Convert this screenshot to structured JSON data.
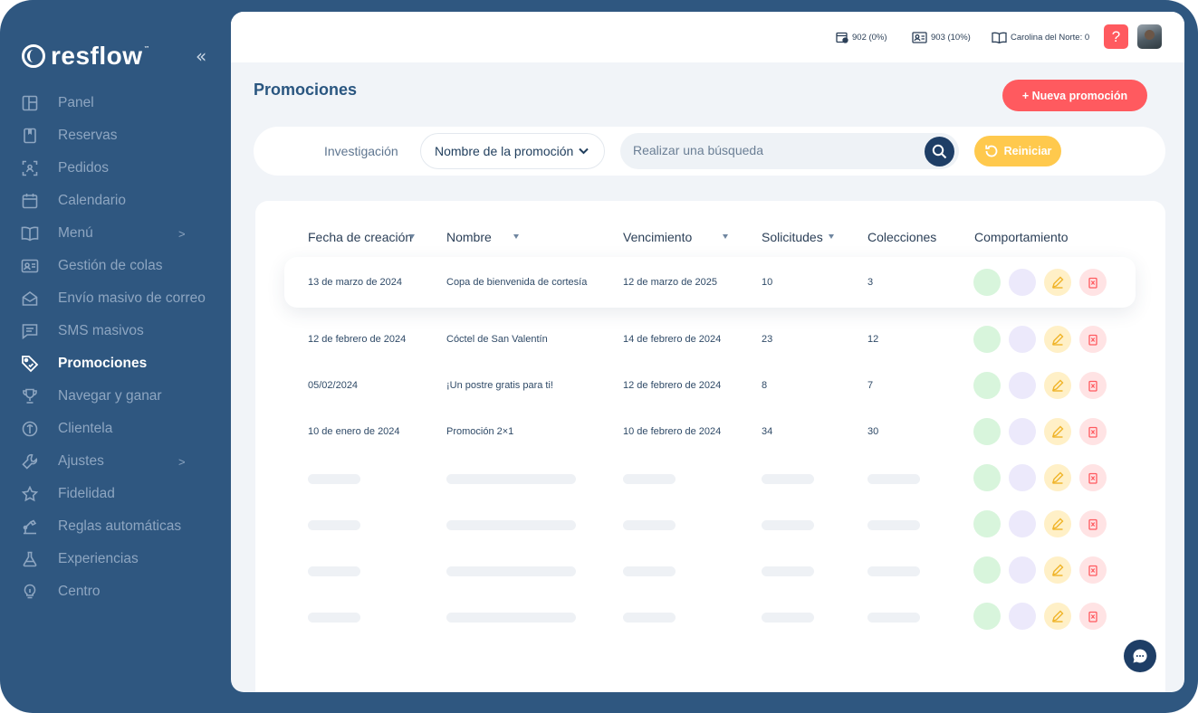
{
  "app": {
    "brand": "resflow",
    "trademark": "™",
    "collapse_icon": "«"
  },
  "sidebar": {
    "items": [
      {
        "label": "Panel",
        "icon": "panel-icon"
      },
      {
        "label": "Reservas",
        "icon": "book-icon"
      },
      {
        "label": "Pedidos",
        "icon": "scan-icon"
      },
      {
        "label": "Calendario",
        "icon": "calendar-icon"
      },
      {
        "label": "Menú",
        "icon": "menu-book-icon",
        "chevron": ">"
      },
      {
        "label": "Gestión de colas",
        "icon": "id-card-icon"
      },
      {
        "label": "Envío masivo de correo",
        "icon": "mail-icon"
      },
      {
        "label": "SMS masivos",
        "icon": "message-icon"
      },
      {
        "label": "Promociones",
        "icon": "tag-icon",
        "active": true
      },
      {
        "label": "Navegar y ganar",
        "icon": "trophy-icon"
      },
      {
        "label": "Clientela",
        "icon": "clientela-icon"
      },
      {
        "label": "Ajustes",
        "icon": "wrench-icon",
        "chevron": ">"
      },
      {
        "label": "Fidelidad",
        "icon": "star-icon"
      },
      {
        "label": "Reglas automáticas",
        "icon": "robot-icon"
      },
      {
        "label": "Experiencias",
        "icon": "flask-icon"
      },
      {
        "label": "Centro",
        "icon": "bulb-icon"
      }
    ]
  },
  "topbar": {
    "stat1": "902 (0%)",
    "stat2": "903 (10%)",
    "stat3": "Carolina del Norte: 0",
    "help": "?"
  },
  "page": {
    "title": "Promociones",
    "new_button": "+ Nueva promoción"
  },
  "filters": {
    "label": "Investigación",
    "select_value": "Nombre de la promoción",
    "search_placeholder": "Realizar una búsqueda",
    "reset_label": "Reiniciar"
  },
  "table": {
    "headers": [
      "Fecha de creación",
      "Nombre",
      "Vencimiento",
      "Solicitudes",
      "Colecciones",
      "Comportamiento"
    ],
    "rows": [
      {
        "fecha": "13 de marzo de 2024",
        "nombre": "Copa de bienvenida de cortesía",
        "vencimiento": "12 de marzo de 2025",
        "solicitudes": "10",
        "colecciones": "3"
      },
      {
        "fecha": "12 de febrero de 2024",
        "nombre": "Cóctel de San Valentín",
        "vencimiento": "14 de febrero de 2024",
        "solicitudes": "23",
        "colecciones": "12"
      },
      {
        "fecha": "05/02/2024",
        "nombre": "¡Un postre gratis para ti!",
        "vencimiento": "12 de febrero de 2024",
        "solicitudes": "8",
        "colecciones": "7"
      },
      {
        "fecha": "10 de enero de 2024",
        "nombre": "Promoción 2×1",
        "vencimiento": "10 de febrero de 2024",
        "solicitudes": "34",
        "colecciones": "30"
      }
    ],
    "skeleton_rows": 4
  },
  "colors": {
    "sidebar_bg": "#2f5780",
    "accent_red": "#ff5a5f",
    "accent_yellow": "#ffc94d",
    "navy": "#1e3e66"
  }
}
